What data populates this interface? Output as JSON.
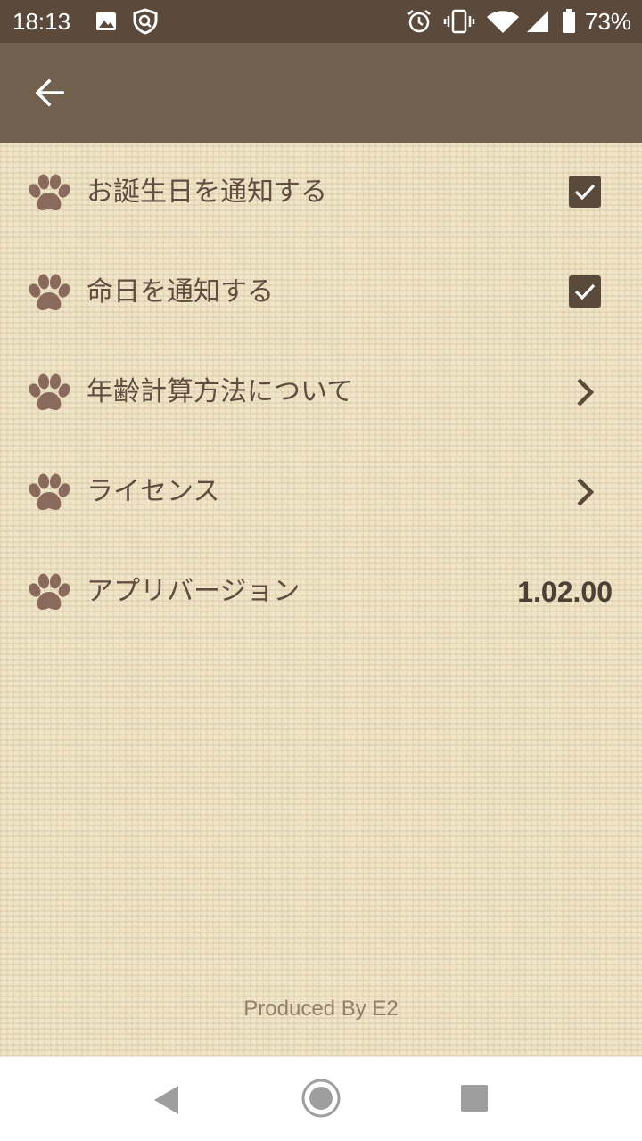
{
  "status_bar": {
    "time": "18:13",
    "battery": "73%",
    "icons": [
      "image-icon",
      "shield-icon",
      "alarm-icon",
      "vibrate-icon",
      "wifi-icon",
      "signal-icon",
      "battery-icon"
    ]
  },
  "app_bar": {
    "back_icon": "arrow-left-icon"
  },
  "settings": {
    "items": [
      {
        "label": "お誕生日を通知する",
        "control": "checkbox",
        "checked": true
      },
      {
        "label": "命日を通知する",
        "control": "checkbox",
        "checked": true
      },
      {
        "label": "年齢計算方法について",
        "control": "chevron"
      },
      {
        "label": "ライセンス",
        "control": "chevron"
      },
      {
        "label": "アプリバージョン",
        "control": "value",
        "value": "1.02.00"
      }
    ]
  },
  "footer": {
    "credit": "Produced By E2"
  },
  "nav_bar": {
    "icons": [
      "back-triangle-icon",
      "home-circle-icon",
      "recents-square-icon"
    ]
  },
  "colors": {
    "status_bar": "#5b4a3b",
    "app_bar": "#72604f",
    "background": "#efe3c4",
    "label_text": "#5e4d40",
    "paw": "#8a6a5c",
    "checkbox": "#5a4a3c",
    "footer_text": "#93806a"
  }
}
